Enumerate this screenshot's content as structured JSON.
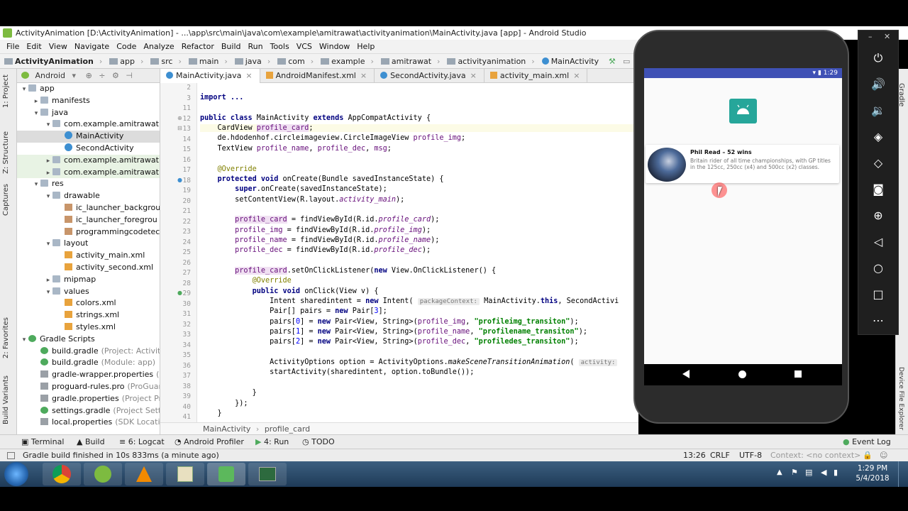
{
  "window": {
    "title": "ActivityAnimation [D:\\ActivityAnimation] - ...\\app\\src\\main\\java\\com\\example\\amitrawat\\activityanimation\\MainActivity.java [app] - Android Studio"
  },
  "menu": [
    "File",
    "Edit",
    "View",
    "Navigate",
    "Code",
    "Analyze",
    "Refactor",
    "Build",
    "Run",
    "Tools",
    "VCS",
    "Window",
    "Help"
  ],
  "nav": {
    "crumbs": [
      "ActivityAnimation",
      "app",
      "src",
      "main",
      "java",
      "com",
      "example",
      "amitrawat",
      "activityanimation",
      "MainActivity"
    ]
  },
  "left_tabs": {
    "project": "1: Project",
    "structure": "Z: Structure",
    "captures": "Captures",
    "favorites": "2: Favorites",
    "variants": "Build Variants"
  },
  "project": {
    "header": "Android",
    "tree": [
      {
        "label": "app",
        "kind": "folder",
        "depth": 0,
        "open": true
      },
      {
        "label": "manifests",
        "kind": "folder",
        "depth": 1,
        "open": false
      },
      {
        "label": "java",
        "kind": "folder",
        "depth": 1,
        "open": true
      },
      {
        "label": "com.example.amitrawat.a",
        "kind": "folder",
        "depth": 2,
        "open": true
      },
      {
        "label": "MainActivity",
        "kind": "cls",
        "depth": 3,
        "sel": true
      },
      {
        "label": "SecondActivity",
        "kind": "cls",
        "depth": 3
      },
      {
        "label": "com.example.amitrawat.a",
        "kind": "folder",
        "depth": 2,
        "open": false,
        "green": true
      },
      {
        "label": "com.example.amitrawat.a",
        "kind": "folder",
        "depth": 2,
        "open": false,
        "green": true
      },
      {
        "label": "res",
        "kind": "folder",
        "depth": 1,
        "open": true
      },
      {
        "label": "drawable",
        "kind": "folder",
        "depth": 2,
        "open": true
      },
      {
        "label": "ic_launcher_backgrou",
        "kind": "img",
        "depth": 3
      },
      {
        "label": "ic_launcher_foregrou",
        "kind": "img",
        "depth": 3
      },
      {
        "label": "programmingcodetec",
        "kind": "img",
        "depth": 3
      },
      {
        "label": "layout",
        "kind": "folder",
        "depth": 2,
        "open": true
      },
      {
        "label": "activity_main.xml",
        "kind": "xml",
        "depth": 3
      },
      {
        "label": "activity_second.xml",
        "kind": "xml",
        "depth": 3
      },
      {
        "label": "mipmap",
        "kind": "folder",
        "depth": 2,
        "open": false
      },
      {
        "label": "values",
        "kind": "folder",
        "depth": 2,
        "open": true
      },
      {
        "label": "colors.xml",
        "kind": "xml",
        "depth": 3
      },
      {
        "label": "strings.xml",
        "kind": "xml",
        "depth": 3
      },
      {
        "label": "styles.xml",
        "kind": "xml",
        "depth": 3
      },
      {
        "label": "Gradle Scripts",
        "kind": "gr",
        "depth": 0,
        "open": true
      },
      {
        "label": "build.gradle",
        "note": "(Project: Activity",
        "kind": "gr",
        "depth": 1
      },
      {
        "label": "build.gradle",
        "note": "(Module: app)",
        "kind": "gr",
        "depth": 1
      },
      {
        "label": "gradle-wrapper.properties",
        "note": "(G",
        "kind": "file",
        "depth": 1
      },
      {
        "label": "proguard-rules.pro",
        "note": "(ProGuard",
        "kind": "file",
        "depth": 1
      },
      {
        "label": "gradle.properties",
        "note": "(Project Pro",
        "kind": "file",
        "depth": 1
      },
      {
        "label": "settings.gradle",
        "note": "(Project Settin",
        "kind": "gr",
        "depth": 1
      },
      {
        "label": "local.properties",
        "note": "(SDK Location",
        "kind": "file",
        "depth": 1
      }
    ]
  },
  "tabs": [
    {
      "label": "MainActivity.java",
      "kind": "cls",
      "active": true
    },
    {
      "label": "AndroidManifest.xml",
      "kind": "xml"
    },
    {
      "label": "SecondActivity.java",
      "kind": "cls"
    },
    {
      "label": "activity_main.xml",
      "kind": "xml"
    }
  ],
  "line_numbers": [
    "2",
    "3",
    "11",
    "12",
    "13",
    "14",
    "15",
    "16",
    "17",
    "18",
    "19",
    "20",
    "21",
    "22",
    "23",
    "24",
    "25",
    "26",
    "27",
    "28",
    "29",
    "30",
    "31",
    "32",
    "33",
    "34",
    "35",
    "36",
    "37",
    "38",
    "39",
    "40",
    "41"
  ],
  "code": {
    "l3": "import ...",
    "l12a": "public class ",
    "l12b": "MainActivity ",
    "l12c": "extends ",
    "l12d": "AppCompatActivity {",
    "l13a": "    CardView ",
    "l13b": "profile_card",
    "l14a": "    de.hdodenhof.circleimageview.CircleImageView ",
    "l14b": "profile_img",
    "l15a": "    TextView ",
    "l15b": "profile_name",
    "l15c": ", ",
    "l15d": "profile_dec",
    "l15e": ", ",
    "l15f": "msg",
    "l17": "    @Override",
    "l18a": "    protected void ",
    "l18b": "onCreate(Bundle savedInstanceState) {",
    "l19a": "        super",
    "l19b": ".onCreate(savedInstanceState);",
    "l20a": "        setContentView(R.layout.",
    "l20b": "activity_main",
    "l20c": ");",
    "l22a": "        ",
    "l22b": "profile_card",
    "l22c": " = findViewById(R.id.",
    "l22d": "profile_card",
    "l22e": ");",
    "l23b": "profile_img",
    "l23c": " = findViewById(R.id.",
    "l23d": "profile_img",
    "l24b": "profile_name",
    "l24c": " = findViewById(R.id.",
    "l24d": "profile_name",
    "l25b": "profile_dec",
    "l25c": " = findViewById(R.id.",
    "l25d": "profile_dec",
    "l27a": "        ",
    "l27b": "profile_card",
    "l27c": ".setOnClickListener(",
    "l27d": "new ",
    "l27e": "View.OnClickListener() {",
    "l28": "            @Override",
    "l29a": "            public void ",
    "l29b": "onClick(View v) {",
    "l30a": "                Intent sharedintent = ",
    "l30b": "new ",
    "l30c": "Intent( ",
    "l30d": "packageContext:",
    "l30e": " MainActivity.",
    "l30f": "this",
    "l30g": ", SecondActivi",
    "l31a": "                Pair[] pairs = ",
    "l31b": "new ",
    "l31c": "Pair[",
    "l31d": "3",
    "l31e": "];",
    "l32a": "                pairs[",
    "l32b": "0",
    "l32c": "] = ",
    "l32d": "new ",
    "l32e": "Pair<View, String>(",
    "l32f": "profile_img",
    "l32g": ", ",
    "l32h": "\"profileimg_transiton\"",
    "l32i": ");",
    "l33b": "1",
    "l33f": "profile_name",
    "l33h": "\"profilename_transiton\"",
    "l34b": "2",
    "l34f": "profile_dec",
    "l34h": "\"profiledes_transiton\"",
    "l36a": "                ActivityOptions option = ActivityOptions.",
    "l36b": "makeSceneTransitionAnimation",
    "l36c": "( ",
    "l36d": "activity:",
    "l37": "                startActivity(sharedintent, option.toBundle());",
    "l39": "            }",
    "l40": "        });",
    "l41": "    }"
  },
  "editor_breadcrumb": [
    "MainActivity",
    "profile_card"
  ],
  "bottom_tabs": [
    "Terminal",
    "Build",
    "6: Logcat",
    "Android Profiler",
    "4: Run",
    "TODO"
  ],
  "event_log": "Event Log",
  "status": {
    "message": "Gradle build finished in 10s 833ms (a minute ago)",
    "position": "13:26",
    "line_sep": "CRLF",
    "encoding": "UTF-8",
    "context": "Context: <no context>"
  },
  "right_tabs": {
    "gradle": "Gradle",
    "device": "Device File Explorer"
  },
  "phone": {
    "time": "1:29",
    "card_name": "Phil Read – 52 wins",
    "card_desc": "Britain rider of all time championships, with GP titles in the 125cc, 250cc (x4) and 500cc (x2) classes."
  },
  "emulator_controls": [
    "power-icon",
    "volume-up-icon",
    "volume-down-icon",
    "rotate-left-icon",
    "rotate-right-icon",
    "camera-icon",
    "zoom-icon",
    "back-icon",
    "home-icon",
    "overview-icon",
    "more-icon"
  ],
  "taskbar": {
    "time": "1:29 PM",
    "date": "5/4/2018"
  }
}
